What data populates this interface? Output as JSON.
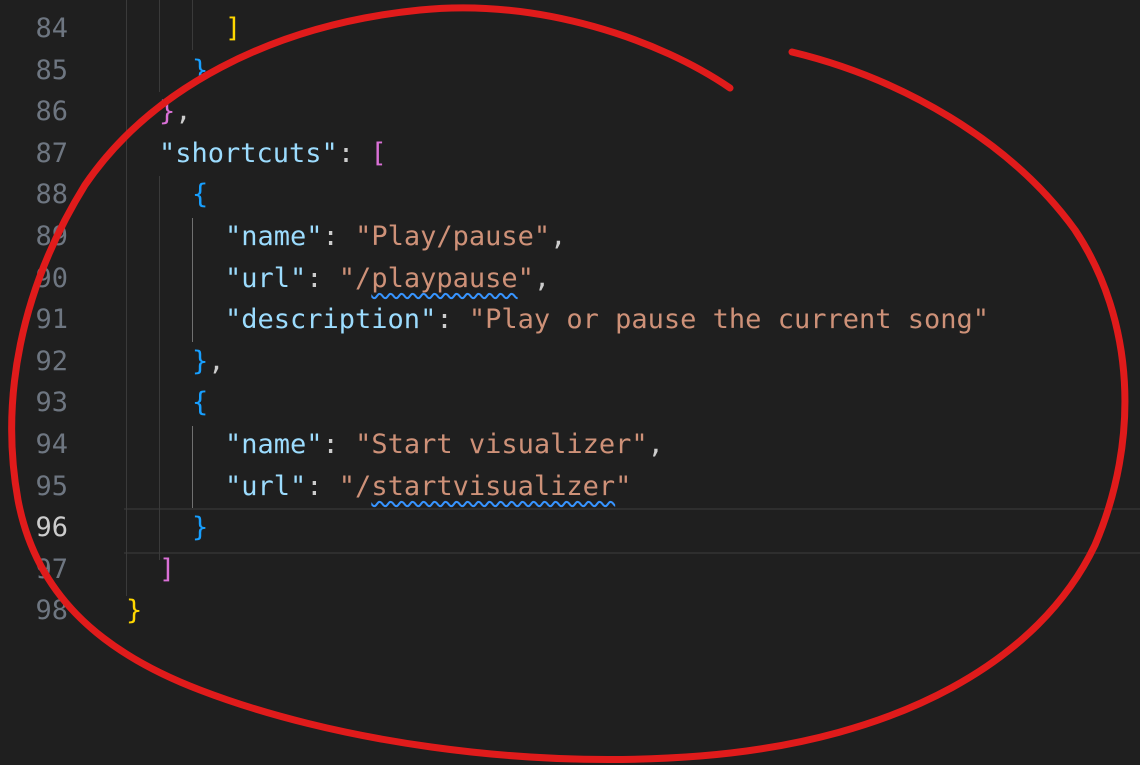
{
  "editor": {
    "language": "json",
    "active_line": "96",
    "lines": [
      {
        "num": "84",
        "tokens": [
          {
            "t": "]",
            "c": "b1"
          }
        ]
      },
      {
        "num": "85",
        "tokens": [
          {
            "t": "}",
            "c": "b3"
          }
        ]
      },
      {
        "num": "86",
        "tokens": [
          {
            "t": "}",
            "c": "b2"
          },
          {
            "t": ",",
            "c": "p"
          }
        ]
      },
      {
        "num": "87",
        "tokens": [
          {
            "t": "\"shortcuts\"",
            "c": "k"
          },
          {
            "t": ": ",
            "c": "p"
          },
          {
            "t": "[",
            "c": "b2"
          }
        ]
      },
      {
        "num": "88",
        "tokens": [
          {
            "t": "{",
            "c": "b3"
          }
        ]
      },
      {
        "num": "89",
        "tokens": [
          {
            "t": "\"name\"",
            "c": "k"
          },
          {
            "t": ": ",
            "c": "p"
          },
          {
            "t": "\"Play/pause\"",
            "c": "s"
          },
          {
            "t": ",",
            "c": "p"
          }
        ]
      },
      {
        "num": "90",
        "tokens": [
          {
            "t": "\"url\"",
            "c": "k"
          },
          {
            "t": ": ",
            "c": "p"
          },
          {
            "t": "\"/",
            "c": "s"
          },
          {
            "t": "playpause",
            "c": "s",
            "warn": true
          },
          {
            "t": "\"",
            "c": "s"
          },
          {
            "t": ",",
            "c": "p"
          }
        ]
      },
      {
        "num": "91",
        "tokens": [
          {
            "t": "\"description\"",
            "c": "k"
          },
          {
            "t": ": ",
            "c": "p"
          },
          {
            "t": "\"Play or pause the current song\"",
            "c": "s"
          }
        ]
      },
      {
        "num": "92",
        "tokens": [
          {
            "t": "}",
            "c": "b3"
          },
          {
            "t": ",",
            "c": "p"
          }
        ]
      },
      {
        "num": "93",
        "tokens": [
          {
            "t": "{",
            "c": "b3"
          }
        ]
      },
      {
        "num": "94",
        "tokens": [
          {
            "t": "\"name\"",
            "c": "k"
          },
          {
            "t": ": ",
            "c": "p"
          },
          {
            "t": "\"Start visualizer\"",
            "c": "s"
          },
          {
            "t": ",",
            "c": "p"
          }
        ]
      },
      {
        "num": "95",
        "tokens": [
          {
            "t": "\"url\"",
            "c": "k"
          },
          {
            "t": ": ",
            "c": "p"
          },
          {
            "t": "\"/",
            "c": "s"
          },
          {
            "t": "startvisualizer",
            "c": "s",
            "warn": true
          },
          {
            "t": "\"",
            "c": "s"
          }
        ]
      },
      {
        "num": "96",
        "tokens": [
          {
            "t": "}",
            "c": "b3"
          }
        ]
      },
      {
        "num": "97",
        "tokens": [
          {
            "t": "]",
            "c": "b2"
          }
        ]
      },
      {
        "num": "98",
        "tokens": [
          {
            "t": "}",
            "c": "b1"
          }
        ]
      }
    ]
  },
  "annotation": {
    "shape": "hand-drawn-circle",
    "color": "#e01b1b"
  },
  "theme": {
    "background": "#1f1f1f",
    "key": "#9cdcfe",
    "string": "#ce9178",
    "bracket_1": "#ffd700",
    "bracket_2": "#da70d6",
    "bracket_3": "#179fff"
  }
}
